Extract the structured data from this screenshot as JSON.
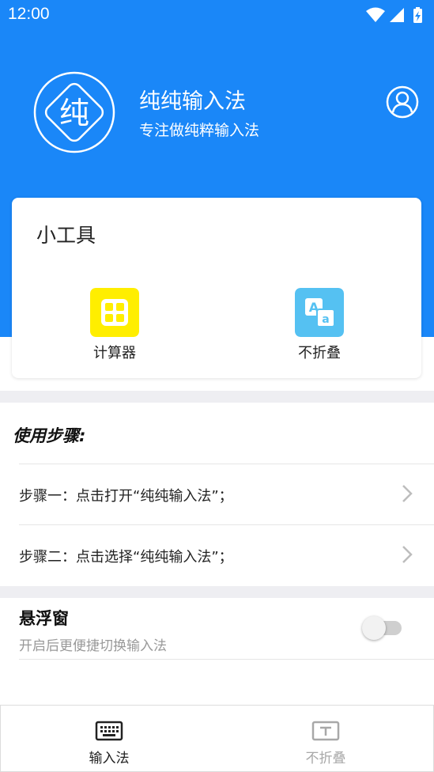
{
  "status_bar": {
    "time": "12:00",
    "icons": [
      "wifi-icon",
      "signal-icon",
      "battery-charging-icon"
    ]
  },
  "header": {
    "logo_char": "纯",
    "app_name": "纯纯输入法",
    "slogan": "专注做纯粹输入法",
    "profile_icon": "user-icon"
  },
  "tools": {
    "title": "小工具",
    "items": [
      {
        "label": "计算器",
        "icon": "calculator-icon",
        "color": "#ffee00"
      },
      {
        "label": "不折叠",
        "icon": "translate-icon",
        "color": "#55c1f2"
      }
    ]
  },
  "steps": {
    "title": "使用步骤:",
    "items": [
      {
        "text": "步骤一：点击打开“纯纯输入法”；"
      },
      {
        "text": "步骤二：点击选择“纯纯输入法”；"
      }
    ]
  },
  "floating_window": {
    "title": "悬浮窗",
    "description": "开启后更便捷切换输入法",
    "enabled": false
  },
  "bottom_nav": {
    "items": [
      {
        "label": "输入法",
        "icon": "keyboard-icon",
        "active": true
      },
      {
        "label": "不折叠",
        "icon": "text-box-icon",
        "active": false
      }
    ]
  },
  "colors": {
    "primary": "#1a87f8",
    "calculator": "#ffee00",
    "translate": "#55c1f2",
    "background_band": "#eeeef2",
    "inactive": "#a8a8a8"
  }
}
